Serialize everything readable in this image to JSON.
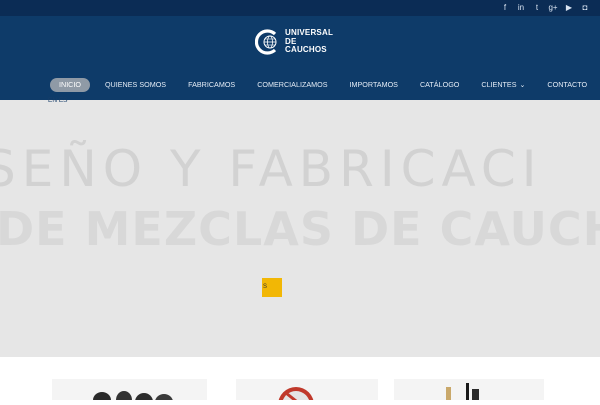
{
  "brand": {
    "name_lines": [
      "UNIVERSAL",
      "DE",
      "CAUCHOS"
    ],
    "logo_icon": "globe-c-logo"
  },
  "social_icons": [
    "facebook-icon",
    "linkedin-icon",
    "twitter-icon",
    "google-plus-icon",
    "youtube-icon",
    "instagram-icon"
  ],
  "nav": {
    "items": [
      {
        "label": "INICIO",
        "active": true
      },
      {
        "label": "QUIENES SOMOS"
      },
      {
        "label": "FABRICAMOS"
      },
      {
        "label": "COMERCIALIZAMOS"
      },
      {
        "label": "IMPORTAMOS"
      },
      {
        "label": "CATÁLOGO"
      },
      {
        "label": "CLIENTES",
        "has_dropdown": true
      },
      {
        "label": "CONTACTO"
      }
    ],
    "search_icon": "search-icon"
  },
  "language": "EN ES",
  "hero": {
    "line1": "SEÑO Y FABRICACI",
    "line2": "DE MEZCLAS DE CAUCHO",
    "button_label": "S"
  },
  "colors": {
    "topbar": "#0b2c55",
    "header": "#0e3b69",
    "active_pill": "#8f9aa6",
    "accent_button": "#f2b705",
    "hero_bg": "#e6e6e6"
  }
}
